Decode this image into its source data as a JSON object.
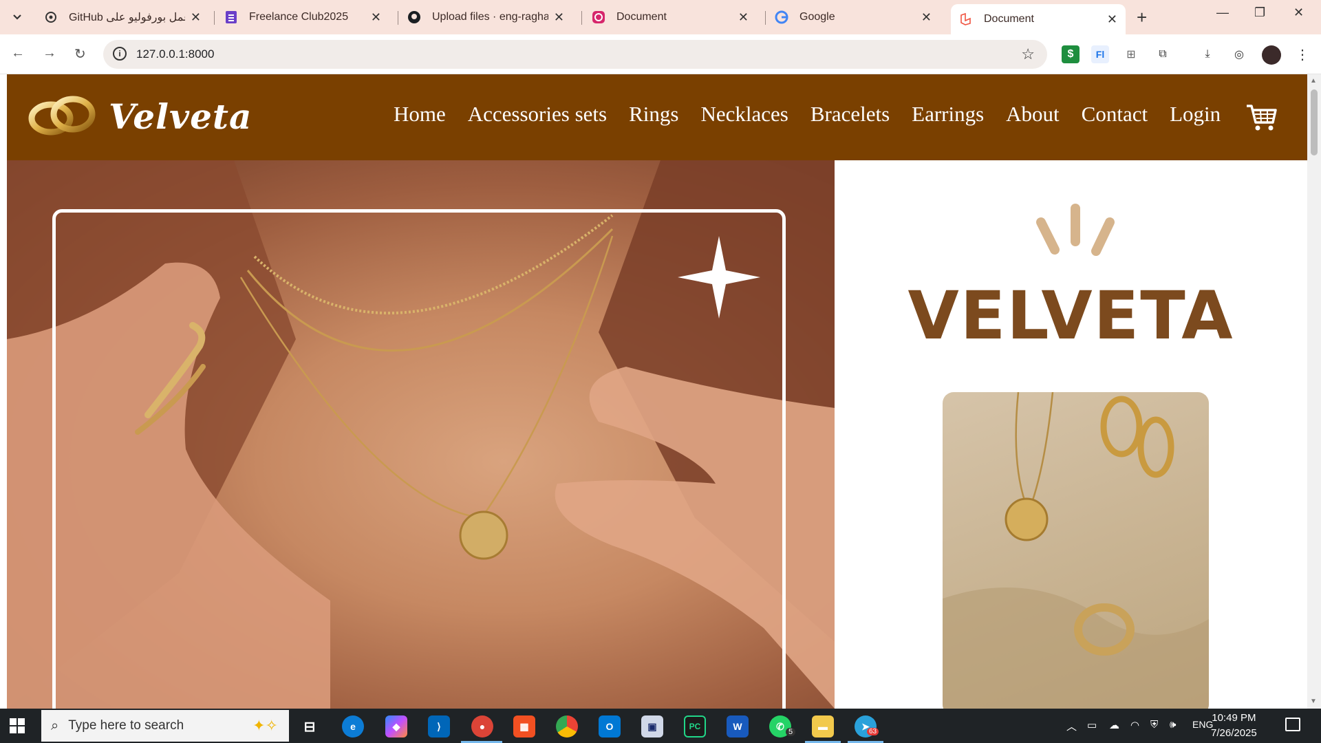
{
  "browser": {
    "tabs": [
      {
        "title": "GitHub عمل بورفوليو على",
        "icon": "openai-icon"
      },
      {
        "title": "Freelance Club2025",
        "icon": "forms-icon"
      },
      {
        "title": "Upload files · eng-raghads",
        "icon": "github-icon"
      },
      {
        "title": "Document",
        "icon": "app-icon"
      },
      {
        "title": "Google",
        "icon": "google-icon"
      },
      {
        "title": "Document",
        "icon": "laravel-icon",
        "active": true
      }
    ],
    "url": "127.0.0.1:8000"
  },
  "site": {
    "brand": "Velveta",
    "nav": [
      "Home",
      "Accessories sets",
      "Rings",
      "Necklaces",
      "Bracelets",
      "Earrings",
      "About",
      "Contact",
      "Login"
    ],
    "hero_brand": "VELVETA",
    "colors": {
      "header": "#7a4000",
      "brand_text": "#7c4a1e"
    }
  },
  "taskbar": {
    "search_placeholder": "Type here to search",
    "language": "ENG",
    "time": "10:49 PM",
    "date": "7/26/2025",
    "whatsapp_badge": "5",
    "telegram_badge": "63"
  }
}
